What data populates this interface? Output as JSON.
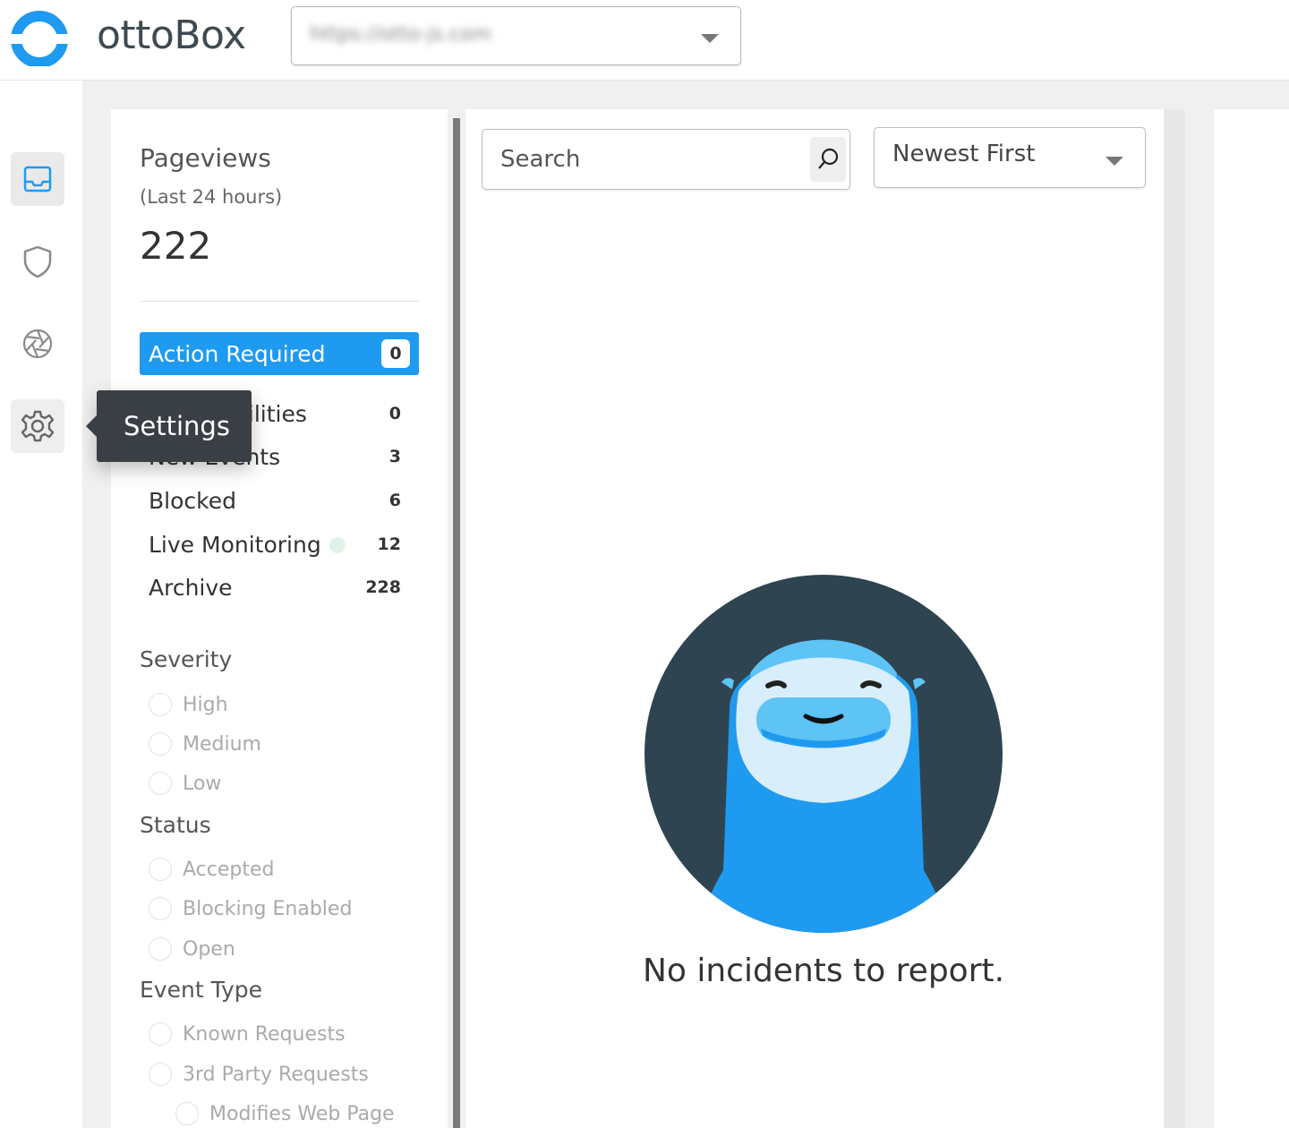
{
  "header": {
    "brand": "ottoBox",
    "site_url": "https://otto-js.com",
    "logo_color": "#1e9af0"
  },
  "rail": {
    "items": [
      {
        "name": "inbox-icon",
        "state": "active"
      },
      {
        "name": "shield-icon",
        "state": "default"
      },
      {
        "name": "aperture-icon",
        "state": "default"
      },
      {
        "name": "gear-icon",
        "state": "hover"
      }
    ],
    "tooltip": "Settings"
  },
  "pageviews": {
    "title": "Pageviews",
    "subtitle": "(Last 24 hours)",
    "count": "222"
  },
  "nav": {
    "action_required": {
      "label": "Action Required",
      "count": "0"
    },
    "items": [
      {
        "label": "Vulnerabilities",
        "count": "0"
      },
      {
        "label": "New Events",
        "count": "3"
      },
      {
        "label": "Blocked",
        "count": "6"
      },
      {
        "label": "Live Monitoring",
        "count": "12"
      },
      {
        "label": "Archive",
        "count": "228"
      }
    ]
  },
  "filters": {
    "severity": {
      "title": "Severity",
      "options": [
        "High",
        "Medium",
        "Low"
      ]
    },
    "status": {
      "title": "Status",
      "options": [
        "Accepted",
        "Blocking Enabled",
        "Open"
      ]
    },
    "event_type": {
      "title": "Event Type",
      "options": [
        "Known Requests",
        "3rd Party Requests",
        "Modifies Web Page"
      ]
    }
  },
  "main": {
    "search_placeholder": "Search",
    "sort_value": "Newest First",
    "empty_message": "No incidents to report."
  },
  "colors": {
    "accent": "#1e9af0",
    "mascot_bg": "#2e4450",
    "tooltip_bg": "#3a3f45"
  }
}
